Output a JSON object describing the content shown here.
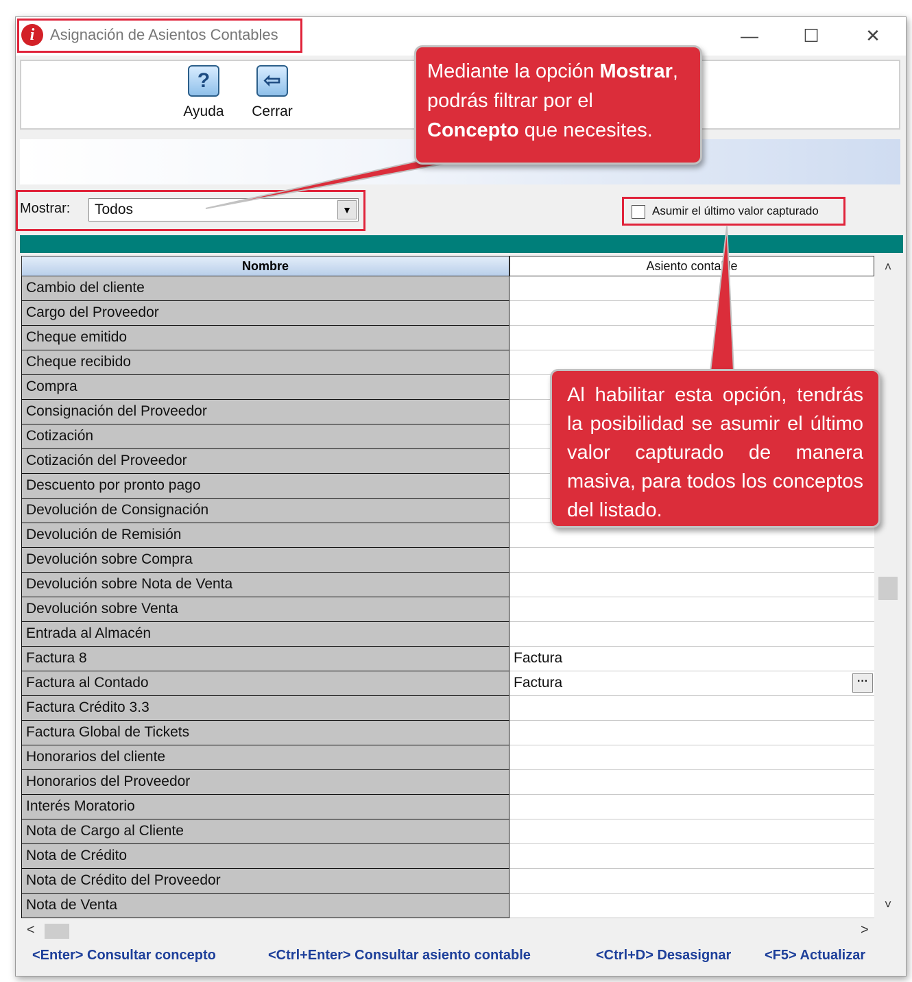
{
  "window": {
    "title": "Asignación de Asientos Contables",
    "app_icon": "i",
    "controls": {
      "minimize": "—",
      "maximize": "☐",
      "close": "✕"
    }
  },
  "toolbar": {
    "buttons": [
      {
        "label": "Ayuda",
        "icon": "help-icon",
        "glyph": "?"
      },
      {
        "label": "Cerrar",
        "icon": "exit-door-icon",
        "glyph": "⇦"
      }
    ]
  },
  "filter": {
    "mostrar_label": "Mostrar:",
    "selected": "Todos",
    "dropdown_arrow": "▼",
    "checkbox_label": "Asumir el último valor capturado",
    "checkbox_checked": false
  },
  "table": {
    "headers": [
      "Nombre",
      "Asiento contable"
    ],
    "rows": [
      {
        "name": "Cambio del cliente",
        "asiento": ""
      },
      {
        "name": "Cargo del Proveedor",
        "asiento": ""
      },
      {
        "name": "Cheque emitido",
        "asiento": ""
      },
      {
        "name": "Cheque recibido",
        "asiento": ""
      },
      {
        "name": "Compra",
        "asiento": ""
      },
      {
        "name": "Consignación del Proveedor",
        "asiento": ""
      },
      {
        "name": "Cotización",
        "asiento": ""
      },
      {
        "name": "Cotización del Proveedor",
        "asiento": ""
      },
      {
        "name": "Descuento por pronto pago",
        "asiento": ""
      },
      {
        "name": "Devolución de Consignación",
        "asiento": ""
      },
      {
        "name": "Devolución de Remisión",
        "asiento": ""
      },
      {
        "name": "Devolución sobre Compra",
        "asiento": ""
      },
      {
        "name": "Devolución sobre Nota de Venta",
        "asiento": ""
      },
      {
        "name": "Devolución sobre Venta",
        "asiento": ""
      },
      {
        "name": "Entrada al Almacén",
        "asiento": ""
      },
      {
        "name": "Factura 8",
        "asiento": "Factura"
      },
      {
        "name": "Factura al Contado",
        "asiento": "Factura",
        "ellipsis": "···"
      },
      {
        "name": "Factura Crédito 3.3",
        "asiento": ""
      },
      {
        "name": "Factura Global de Tickets",
        "asiento": ""
      },
      {
        "name": "Honorarios del cliente",
        "asiento": ""
      },
      {
        "name": "Honorarios del Proveedor",
        "asiento": ""
      },
      {
        "name": "Interés Moratorio",
        "asiento": ""
      },
      {
        "name": "Nota de Cargo al Cliente",
        "asiento": ""
      },
      {
        "name": "Nota de Crédito",
        "asiento": ""
      },
      {
        "name": "Nota de Crédito del Proveedor",
        "asiento": ""
      },
      {
        "name": "Nota de Venta",
        "asiento": ""
      }
    ]
  },
  "scrollbars": {
    "up": "˄",
    "down": "˅",
    "left": "<",
    "right": ">"
  },
  "shortcuts": [
    "<Enter> Consultar concepto",
    "<Ctrl+Enter> Consultar asiento contable",
    "<Ctrl+D> Desasignar",
    "<F5> Actualizar"
  ],
  "callouts": {
    "mostrar": {
      "part1": "Mediante la opción ",
      "bold1": "Mostrar",
      "part2": ", podrás filtrar por el ",
      "bold2": "Concepto",
      "part3": " que necesites."
    },
    "asumir": "Al habilitar esta opción, tendrás la posibilidad se asumir el último valor capturado de manera masiva, para todos los conceptos del listado."
  },
  "colors": {
    "highlight": "#e0233a",
    "callout": "#db2d3a",
    "teal_band": "#007f7a",
    "shortcut_text": "#1d3f9a",
    "name_cell": "#c4c4c4"
  }
}
